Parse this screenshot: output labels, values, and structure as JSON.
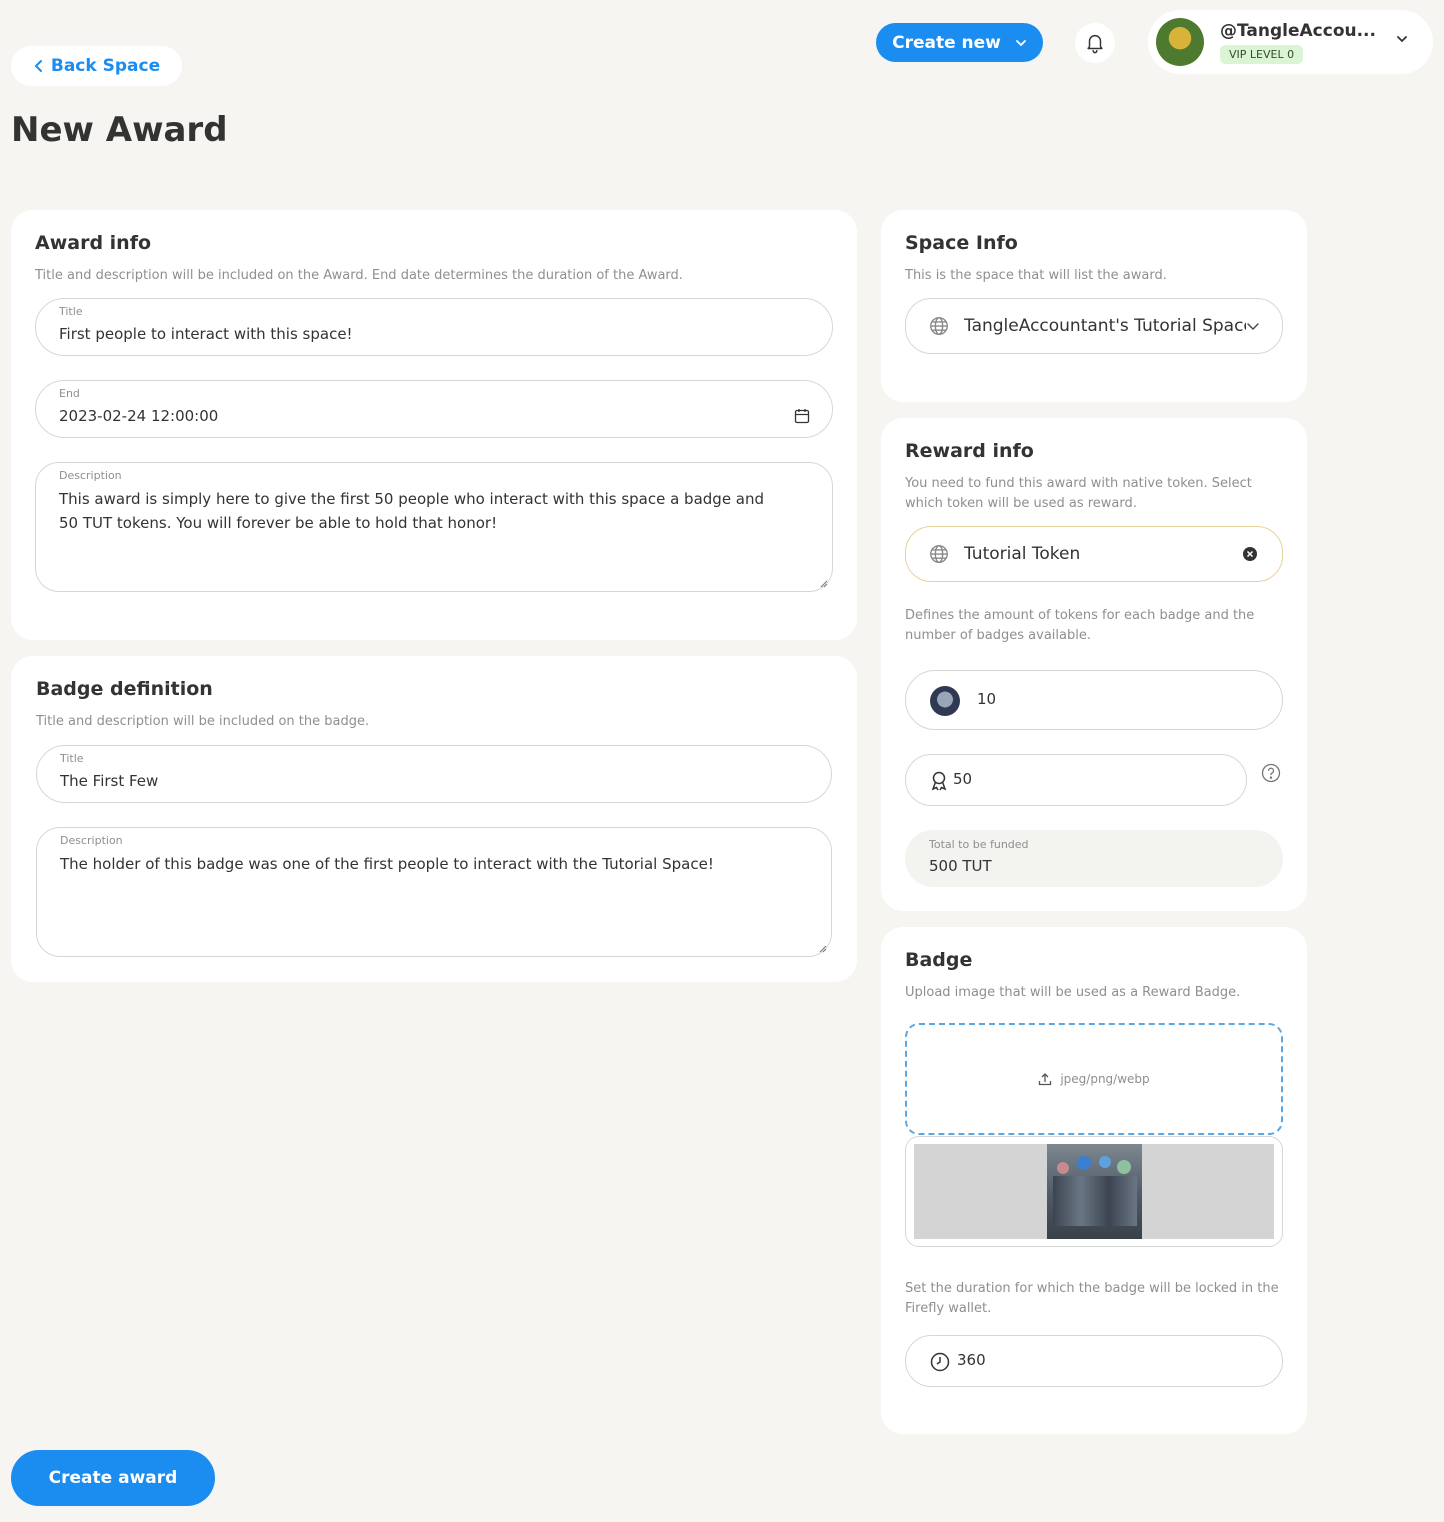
{
  "header": {
    "create_new_label": "Create new",
    "profile_name": "@TangleAccou...",
    "vip_label": "VIP LEVEL 0"
  },
  "nav": {
    "back_label": "Back Space"
  },
  "page_title": "New Award",
  "award_info": {
    "title": "Award info",
    "subtitle": "Title and description will be included on the Award. End date determines the duration of the Award.",
    "title_label": "Title",
    "title_value": "First people to interact with this space!",
    "end_label": "End",
    "end_value": "2023-02-24 12:00:00",
    "description_label": "Description",
    "description_value": "This award is simply here to give the first 50 people who interact with this space a badge and 50 TUT tokens. You will forever be able to hold that honor!"
  },
  "badge_definition": {
    "title": "Badge definition",
    "subtitle": "Title and description will be included on the badge.",
    "title_label": "Title",
    "title_value": "The First Few",
    "description_label": "Description",
    "description_value": "The holder of this badge was one of the first people to interact with the Tutorial Space!"
  },
  "space_info": {
    "title": "Space Info",
    "subtitle": "This is the space that will list the award.",
    "selected_space": "TangleAccountant's Tutorial Space"
  },
  "reward_info": {
    "title": "Reward info",
    "subtitle": "You need to fund this award with native token. Select which token will be used as reward.",
    "selected_token": "Tutorial Token",
    "amount_hint": "Defines the amount of tokens for each badge and the number of badges available.",
    "token_amount": "10",
    "badge_count": "50",
    "total_label": "Total to be funded",
    "total_value": "500 TUT"
  },
  "badge": {
    "title": "Badge",
    "subtitle": "Upload image that will be used as a Reward Badge.",
    "upload_hint": "jpeg/png/webp",
    "lock_hint": "Set the duration for which the badge will be locked in the Firefly wallet.",
    "lock_duration": "360"
  },
  "actions": {
    "create_award_label": "Create award"
  }
}
